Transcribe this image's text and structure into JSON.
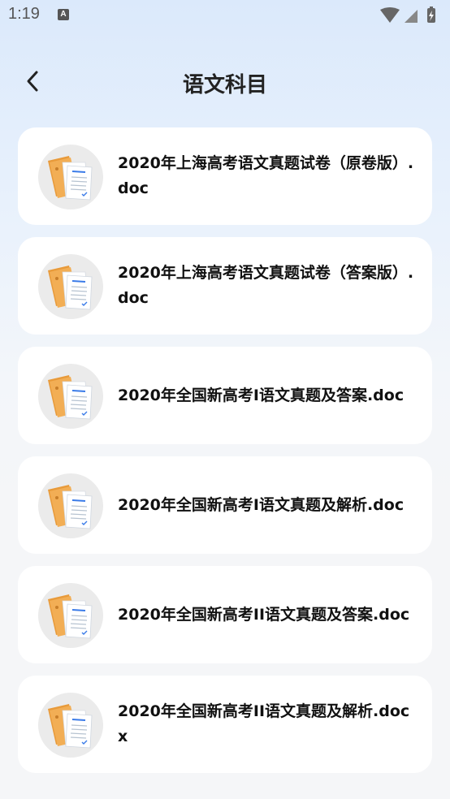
{
  "status_bar": {
    "time": "1:19",
    "notification_letter": "A"
  },
  "header": {
    "title": "语文科目",
    "back_icon": "chevron-left-icon"
  },
  "files": [
    {
      "name": "2020年上海高考语文真题试卷（原卷版）.doc",
      "icon": "document-folder-icon"
    },
    {
      "name": "2020年上海高考语文真题试卷（答案版）.doc",
      "icon": "document-folder-icon"
    },
    {
      "name": "2020年全国新高考I语文真题及答案.doc",
      "icon": "document-folder-icon"
    },
    {
      "name": "2020年全国新高考I语文真题及解析.doc",
      "icon": "document-folder-icon"
    },
    {
      "name": "2020年全国新高考II语文真题及答案.doc",
      "icon": "document-folder-icon"
    },
    {
      "name": "2020年全国新高考II语文真题及解析.docx",
      "icon": "document-folder-icon"
    }
  ],
  "colors": {
    "card": "#ffffff",
    "folder": "#f0a848",
    "accent_blue": "#3a7be8"
  }
}
